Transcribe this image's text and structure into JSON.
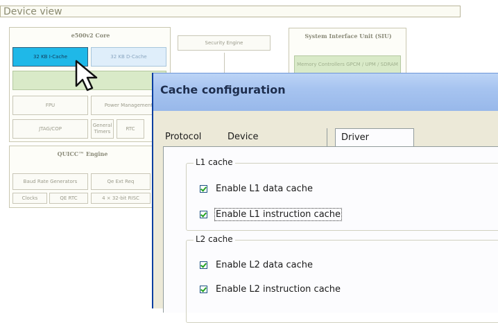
{
  "device_view": {
    "header": "Device view",
    "core": {
      "title": "e500v2 Core",
      "icache": "32 KB I-Cache",
      "dcache": "32 KB D-Cache",
      "fpu": "FPU",
      "power": "Power Management",
      "jtag": "JTAG/COP",
      "timers": "General Timers",
      "rtc": "RTC"
    },
    "security": "Security Engine",
    "siu": {
      "title": "System Interface Unit (SIU)",
      "memory": "Memory Controllers GPCM / UPM / SDRAM"
    },
    "quicc": {
      "title": "QUICC™ Engine",
      "baud": "Baud Rate Generators",
      "qe_ext": "Qe Ext Req",
      "clocks": "Clocks",
      "qe_rtc": "QE RTC",
      "risc": "4 × 32-bit RISC"
    }
  },
  "dialog": {
    "title": "Cache configuration",
    "tabs": [
      {
        "label": "Protocol"
      },
      {
        "label": "Device"
      },
      {
        "label": "Driver"
      }
    ],
    "groups": [
      {
        "label": "L1 cache",
        "options": [
          {
            "label": "Enable L1 data cache",
            "checked": true
          },
          {
            "label": "Enable L1 instruction cache",
            "checked": true
          }
        ]
      },
      {
        "label": "L2 cache",
        "options": [
          {
            "label": "Enable L2 data cache",
            "checked": true
          },
          {
            "label": "Enable L2 instruction cache",
            "checked": true
          }
        ]
      }
    ]
  }
}
